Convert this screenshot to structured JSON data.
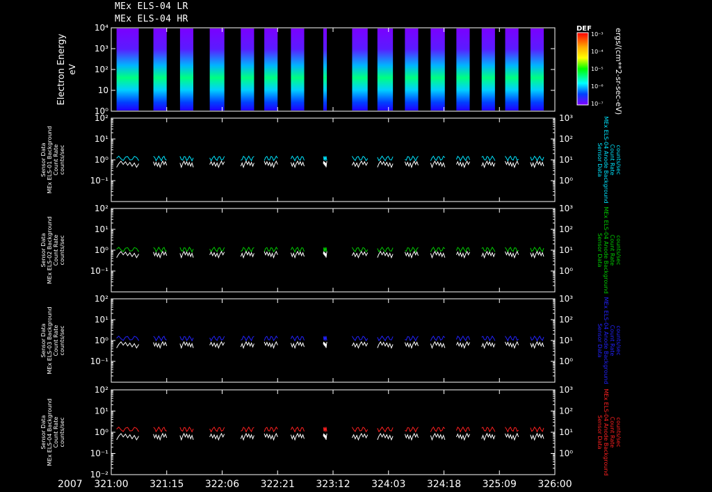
{
  "titles": [
    "MEx ELS-04 LR",
    "MEx ELS-04 HR"
  ],
  "year": "2007",
  "x_ticks": [
    "321:00",
    "321:15",
    "322:06",
    "322:21",
    "323:12",
    "324:03",
    "324:18",
    "325:09",
    "326:00"
  ],
  "colors": {
    "background": "#000000",
    "cyan": "#00e5ff",
    "green": "#00cc00",
    "blue": "#2222ff",
    "red": "#ff2020",
    "white": "#ffffff"
  },
  "colorbar": {
    "label": "DEF",
    "ticks": [
      "10⁻³",
      "10⁻⁴",
      "10⁻⁵",
      "10⁻⁶",
      "10⁻⁷"
    ],
    "units": "ergs/(cm**2-sr-sec-eV)"
  },
  "chart_data": [
    {
      "type": "heatmap",
      "ylabel": [
        "Electron Energy",
        "eV"
      ],
      "yticks": [
        "10⁴",
        "10³",
        "10²",
        "10",
        "10⁰"
      ],
      "ylim": [
        1,
        10000
      ],
      "yscale": "log",
      "x_range": [
        321.0,
        326.0
      ]
    },
    {
      "type": "line",
      "ylabel_left": [
        "Sensor Data",
        "MEx ELS-01 Background",
        "Count Rate",
        "counts/sec"
      ],
      "ylabel_right": [
        "Sensor Data",
        "MEx ELS-04 Anode Background",
        "Count Rate",
        "counts/sec"
      ],
      "left_yticks": [
        "10²",
        "10¹",
        "10⁰",
        "10⁻¹"
      ],
      "right_yticks": [
        "10³",
        "10²",
        "10¹",
        "10⁰"
      ],
      "left_ylim": [
        0.01,
        100
      ],
      "right_ylim": [
        0.1,
        1000
      ],
      "yscale": "log",
      "series_colors": [
        "#00e5ff",
        "#ffffff"
      ],
      "level_colored": 1.2,
      "level_white": 0.8
    },
    {
      "type": "line",
      "ylabel_left": [
        "Sensor Data",
        "MEx ELS-02 Background",
        "Count Rate",
        "counts/sec"
      ],
      "ylabel_right": [
        "Sensor Data",
        "MEx ELS-04 Anode Background",
        "Count Rate",
        "counts/sec"
      ],
      "left_yticks": [
        "10²",
        "10¹",
        "10⁰",
        "10⁻¹"
      ],
      "right_yticks": [
        "10³",
        "10²",
        "10¹",
        "10⁰"
      ],
      "left_ylim": [
        0.01,
        100
      ],
      "right_ylim": [
        0.1,
        1000
      ],
      "yscale": "log",
      "series_colors": [
        "#00cc00",
        "#ffffff"
      ],
      "level_colored": 1.1,
      "level_white": 0.8
    },
    {
      "type": "line",
      "ylabel_left": [
        "Sensor Data",
        "MEx ELS-03 Background",
        "Count Rate",
        "counts/sec"
      ],
      "ylabel_right": [
        "Sensor Data",
        "MEx ELS-04 Anode Background",
        "Count Rate",
        "counts/sec"
      ],
      "left_yticks": [
        "10²",
        "10¹",
        "10⁰",
        "10⁻¹"
      ],
      "right_yticks": [
        "10³",
        "10²",
        "10¹",
        "10⁰"
      ],
      "left_ylim": [
        0.01,
        100
      ],
      "right_ylim": [
        0.1,
        1000
      ],
      "yscale": "log",
      "series_colors": [
        "#2222ff",
        "#ffffff"
      ],
      "level_colored": 1.3,
      "level_white": 0.8
    },
    {
      "type": "line",
      "ylabel_left": [
        "Sensor Data",
        "MEx ELS-04 Background",
        "Count Rate",
        "counts/sec"
      ],
      "ylabel_right": [
        "Sensor Data",
        "MEx ELS-04 Anode Background",
        "Count Rate",
        "counts/sec"
      ],
      "left_yticks": [
        "10²",
        "10¹",
        "10⁰",
        "10⁻¹",
        "10⁻²"
      ],
      "right_yticks": [
        "10³",
        "10²",
        "10¹",
        "10⁰"
      ],
      "left_ylim": [
        0.01,
        100
      ],
      "right_ylim": [
        0.1,
        1000
      ],
      "yscale": "log",
      "series_colors": [
        "#ff2020",
        "#ffffff"
      ],
      "level_colored": 1.4,
      "level_white": 0.8
    }
  ]
}
